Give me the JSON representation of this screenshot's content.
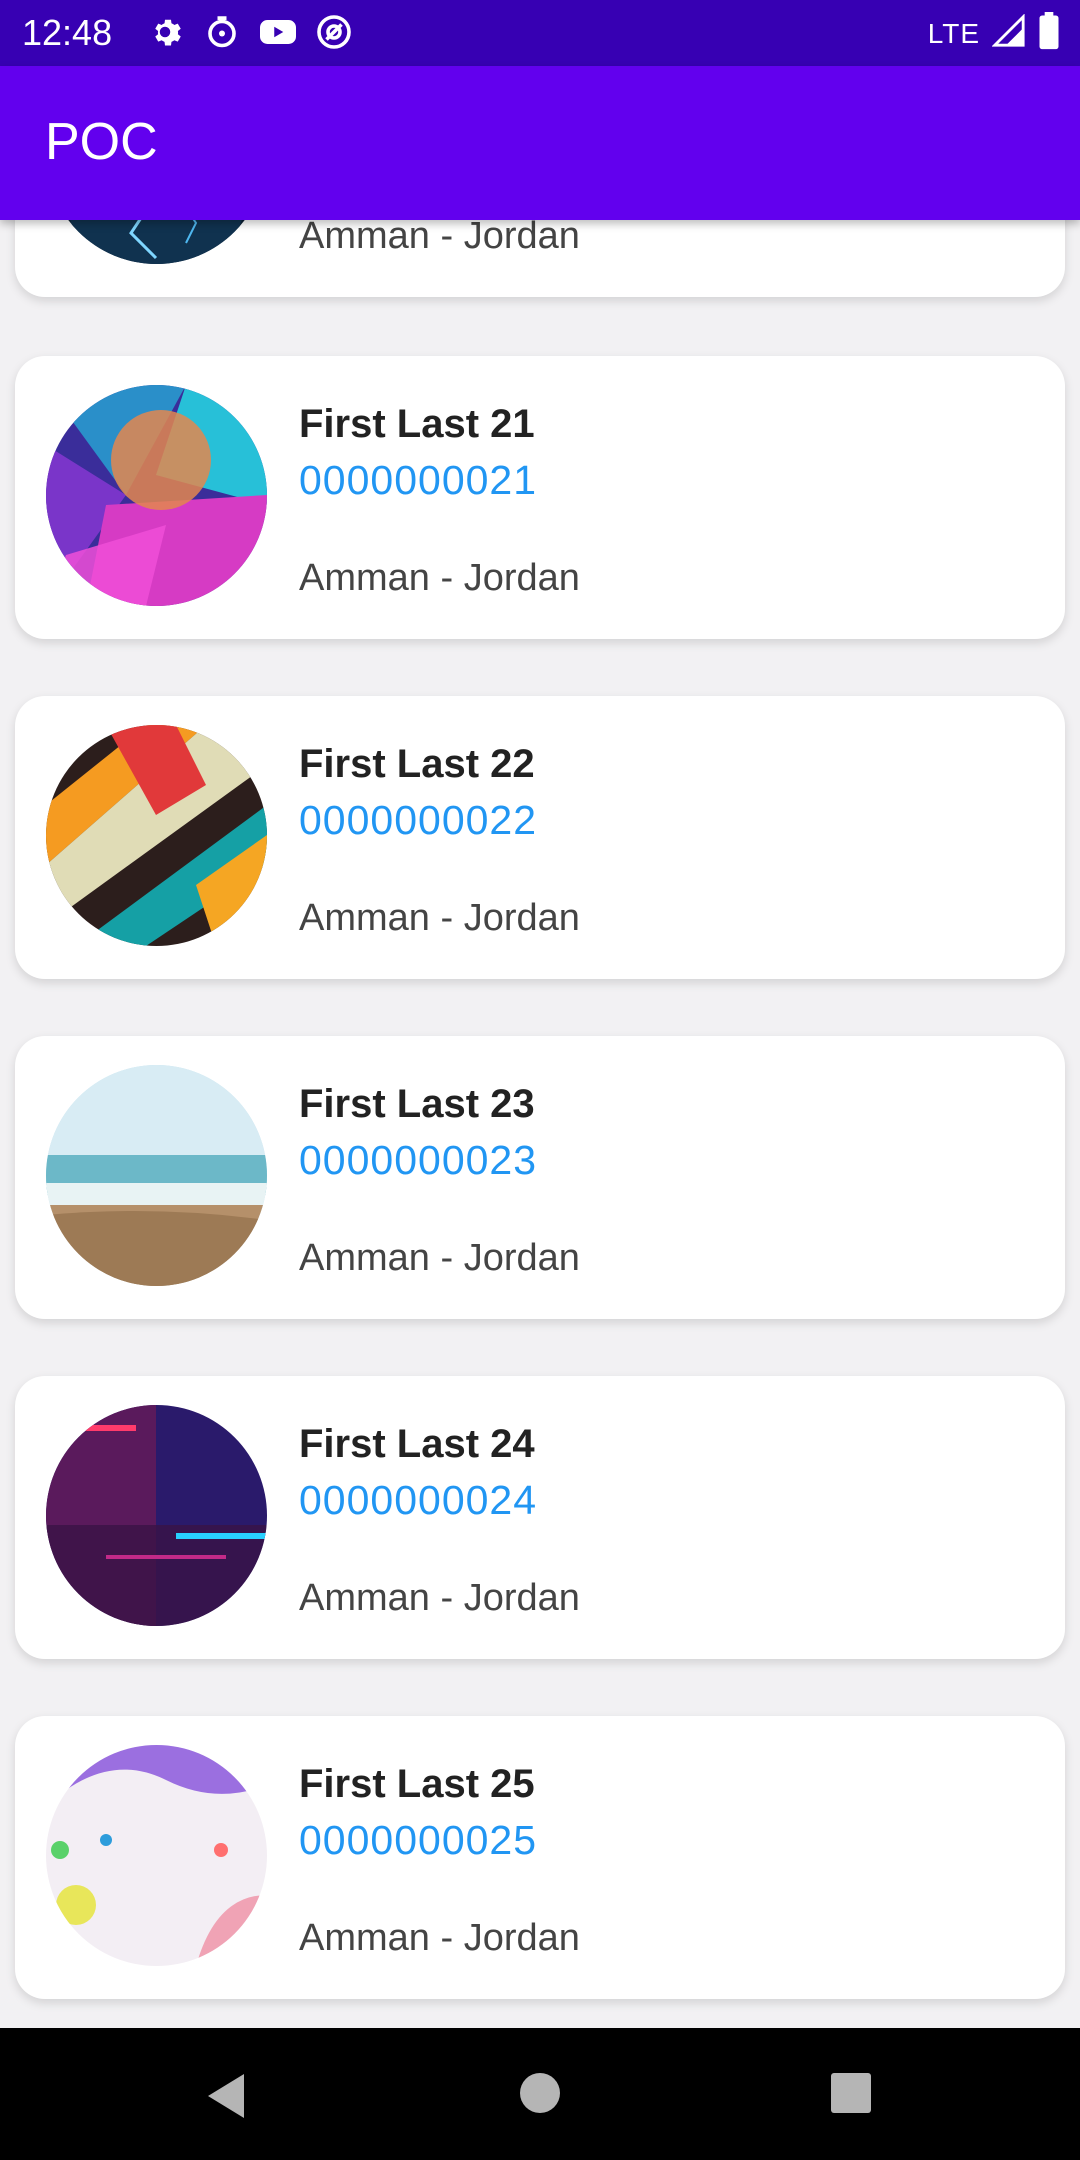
{
  "status_bar": {
    "time": "12:48",
    "network": "LTE",
    "left_icons": [
      "settings-icon",
      "timer-icon",
      "youtube-icon",
      "at-sign-icon"
    ],
    "right_icons": [
      "signal-icon",
      "battery-icon"
    ]
  },
  "app_bar": {
    "title": "POC"
  },
  "contacts": [
    {
      "name": "",
      "phone": "",
      "location": "Amman - Jordan",
      "avatar": "lightning-image"
    },
    {
      "name": "First Last 21",
      "phone": "0000000021",
      "location": "Amman - Jordan",
      "avatar": "colorful-blur-image"
    },
    {
      "name": "First Last 22",
      "phone": "0000000022",
      "location": "Amman - Jordan",
      "avatar": "stripes-pattern-image"
    },
    {
      "name": "First Last 23",
      "phone": "0000000023",
      "location": "Amman - Jordan",
      "avatar": "beach-image"
    },
    {
      "name": "First Last 24",
      "phone": "0000000024",
      "location": "Amman - Jordan",
      "avatar": "neon-lights-image"
    },
    {
      "name": "First Last 25",
      "phone": "0000000025",
      "location": "Amman - Jordan",
      "avatar": "pastel-abstract-image"
    }
  ],
  "nav_bar": {
    "buttons": [
      "back-icon",
      "home-icon",
      "recents-icon"
    ]
  },
  "colors": {
    "status_bar": "#3700b3",
    "app_bar": "#6200ee",
    "phone_text": "#2196f3",
    "background": "#f2f1f3"
  }
}
